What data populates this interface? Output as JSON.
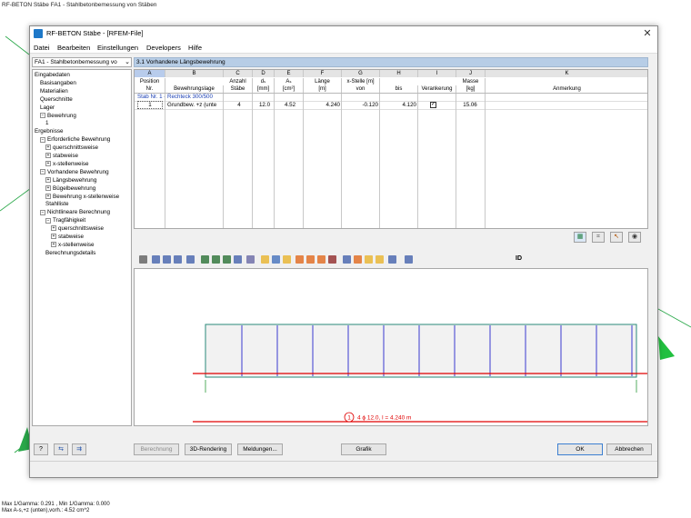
{
  "background": {
    "caption": "RF-BETON Stäbe FA1 - Stahlbetonbemessung von Stäben",
    "status_line_1": "Max 1/Gamma: 0.291 , Min 1/Gamma: 0.000",
    "status_line_2": "Max A-s,+z (unten),vorh.: 4.52 cm^2",
    "marker_text": "4.52"
  },
  "window": {
    "title": "RF-BETON Stäbe - [RFEM-File]",
    "close_label": "✕"
  },
  "menu": {
    "items": [
      "Datei",
      "Bearbeiten",
      "Einstellungen",
      "Developers",
      "Hilfe"
    ]
  },
  "navigator": {
    "combo_value": "FA1 - Stahlbetonbemessung vo",
    "tree": [
      {
        "label": "Eingabedaten",
        "level": 0,
        "box": ""
      },
      {
        "label": "Basisangaben",
        "level": 1,
        "box": ""
      },
      {
        "label": "Materialien",
        "level": 1,
        "box": ""
      },
      {
        "label": "Querschnitte",
        "level": 1,
        "box": ""
      },
      {
        "label": "Lager",
        "level": 1,
        "box": ""
      },
      {
        "label": "Bewehrung",
        "level": 1,
        "box": "−"
      },
      {
        "label": "1",
        "level": 2,
        "box": ""
      },
      {
        "label": "Ergebnisse",
        "level": 0,
        "box": ""
      },
      {
        "label": "Erforderliche Bewehrung",
        "level": 1,
        "box": "−"
      },
      {
        "label": "querschnittsweise",
        "level": 2,
        "box": "+"
      },
      {
        "label": "stabweise",
        "level": 2,
        "box": "+"
      },
      {
        "label": "x-stellenweise",
        "level": 2,
        "box": "+"
      },
      {
        "label": "Vorhandene Bewehrung",
        "level": 1,
        "box": "−"
      },
      {
        "label": "Längsbewehrung",
        "level": 2,
        "box": "+"
      },
      {
        "label": "Bügelbewehrung",
        "level": 2,
        "box": "+"
      },
      {
        "label": "Bewehrung x-stellenweise",
        "level": 2,
        "box": "+"
      },
      {
        "label": "Stahlliste",
        "level": 2,
        "box": ""
      },
      {
        "label": "Nichtlineare Berechnung",
        "level": 1,
        "box": "−"
      },
      {
        "label": "Tragfähigkeit",
        "level": 2,
        "box": "−"
      },
      {
        "label": "querschnittsweise",
        "level": 3,
        "box": "+"
      },
      {
        "label": "stabweise",
        "level": 3,
        "box": "+"
      },
      {
        "label": "x-stellenweise",
        "level": 3,
        "box": "+"
      },
      {
        "label": "Berechnungsdetails",
        "level": 2,
        "box": ""
      }
    ]
  },
  "panel": {
    "header": "3.1 Vorhandene Längsbewehrung",
    "columns": [
      {
        "letter": "A",
        "h1": "Position",
        "h2": "Nr."
      },
      {
        "letter": "B",
        "h1": "",
        "h2": "Bewehrungslage"
      },
      {
        "letter": "C",
        "h1": "Anzahl",
        "h2": "Stäbe"
      },
      {
        "letter": "D",
        "h1": "dₛ",
        "h2": "[mm]"
      },
      {
        "letter": "E",
        "h1": "Aₛ",
        "h2": "[cm²]"
      },
      {
        "letter": "F",
        "h1": "Länge",
        "h2": "[m]"
      },
      {
        "letter": "G",
        "h1": "x-Stelle [m]",
        "h2": "von"
      },
      {
        "letter": "H",
        "h1": "",
        "h2": "bis"
      },
      {
        "letter": "I",
        "h1": "",
        "h2": "Verankerung"
      },
      {
        "letter": "J",
        "h1": "Masse",
        "h2": "[kg]"
      },
      {
        "letter": "K",
        "h1": "",
        "h2": "Anmerkung"
      }
    ],
    "group_row": "Stab Nr. 1  -  Rechteck 300/500",
    "row": {
      "position": "1",
      "lage": "Grundbew. +z (unte",
      "anzahl": "4",
      "ds": "12.0",
      "as": "4.52",
      "laenge": "4.240",
      "von": "-0.120",
      "bis": "4.120",
      "verankerung": "✓",
      "masse": "15.06",
      "anmerkung": ""
    }
  },
  "graphic": {
    "label_number": "1",
    "label_text": "4 ϕ 12.0, l = 4.240 m",
    "stirrups_count": 12,
    "colors": {
      "beam": "#2a8a7a",
      "stirrup": "#3a3ad0",
      "rebar": "#e00000"
    }
  },
  "toolbar_id_label": "ID",
  "buttons": {
    "berechnung": "Berechnung",
    "rendering": "3D-Rendering",
    "meldungen": "Meldungen...",
    "grafik": "Grafik",
    "ok": "OK",
    "abbrechen": "Abbrechen"
  }
}
